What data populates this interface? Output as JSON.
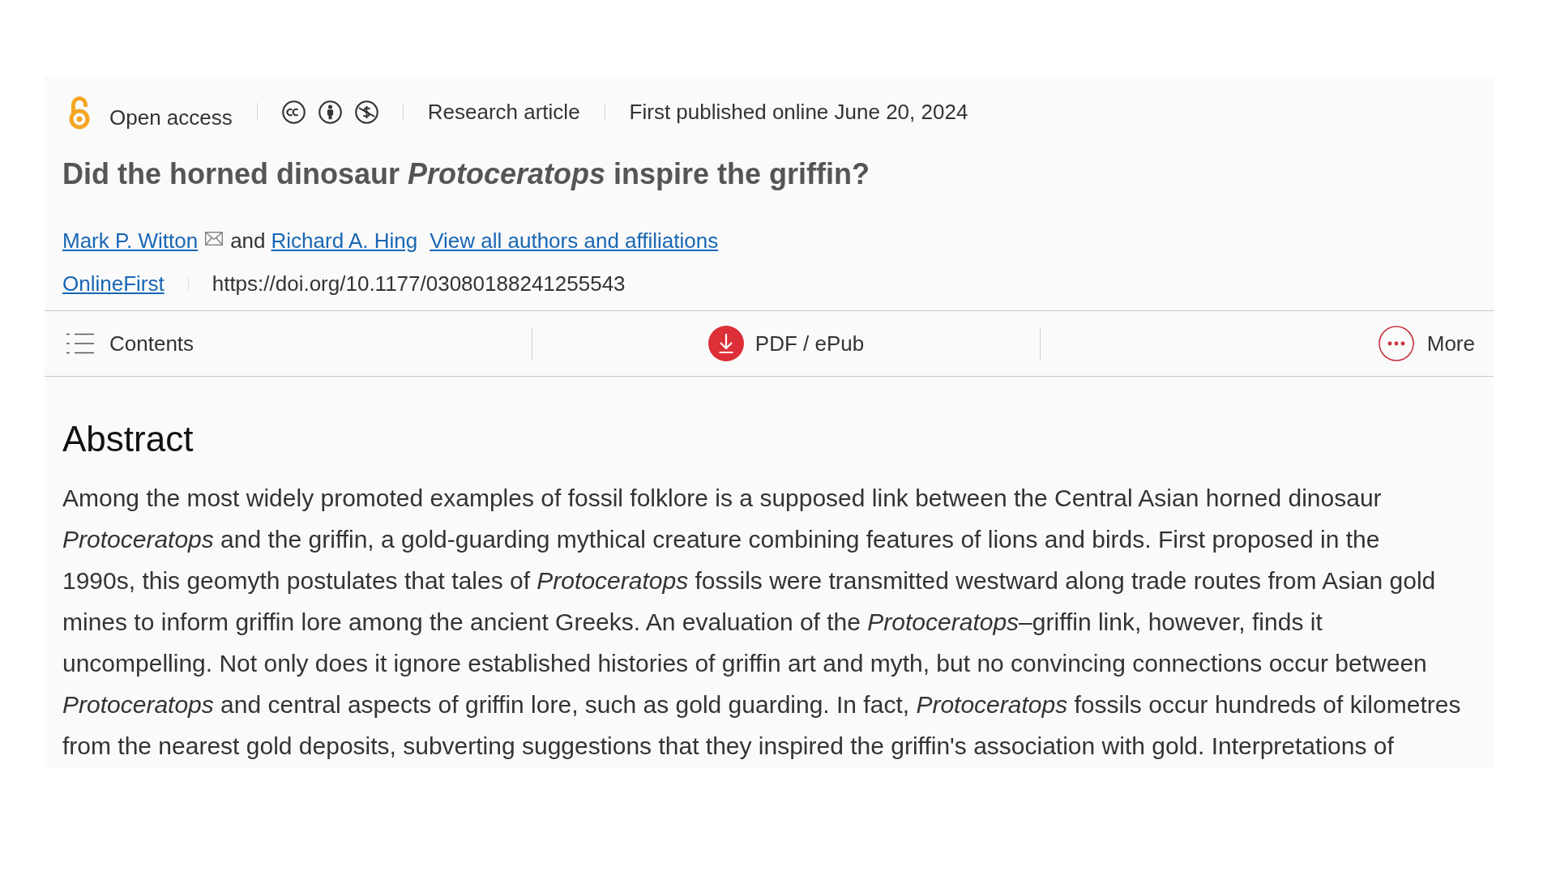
{
  "meta": {
    "access": "Open access",
    "article_type": "Research article",
    "published": "First published online June 20, 2024"
  },
  "title": "Did the horned dinosaur *Protoceratops* inspire the griffin?",
  "authors": [
    {
      "name": "Mark P. Witton",
      "email": true
    },
    {
      "name": "Richard A. Hing",
      "email": false
    }
  ],
  "author_connector": "and",
  "all_authors_link": "View all authors and affiliations",
  "issue_link": "OnlineFirst",
  "doi": "https://doi.org/10.1177/03080188241255543",
  "toolbar": [
    {
      "kind": "contents",
      "label": "Contents"
    },
    {
      "kind": "download",
      "label": "PDF / ePub"
    },
    {
      "kind": "more",
      "label": "More"
    }
  ],
  "abstract": {
    "heading": "Abstract",
    "lines": [
      "Among the most widely promoted examples of fossil folklore is a supposed link between the Central Asian horned dinosaur",
      "*Protoceratops* and the griffin, a gold-guarding mythical creature combining features of lions and birds. First proposed in the",
      "1990s, this geomyth postulates that tales of *Protoceratops* fossils were transmitted westward along trade routes from Asian gold",
      "mines to inform griffin lore among the ancient Greeks. An evaluation of the *Protoceratops*–griffin link, however, finds it",
      "uncompelling. Not only does it ignore established histories of griffin art and myth, but no convincing connections occur between",
      "*Protoceratops* and central aspects of griffin lore, such as gold guarding. In fact, *Protoceratops* fossils occur hundreds of kilometres",
      "from the nearest gold deposits, subverting suggestions that they inspired the griffin's association with gold. Interpretations of"
    ]
  }
}
